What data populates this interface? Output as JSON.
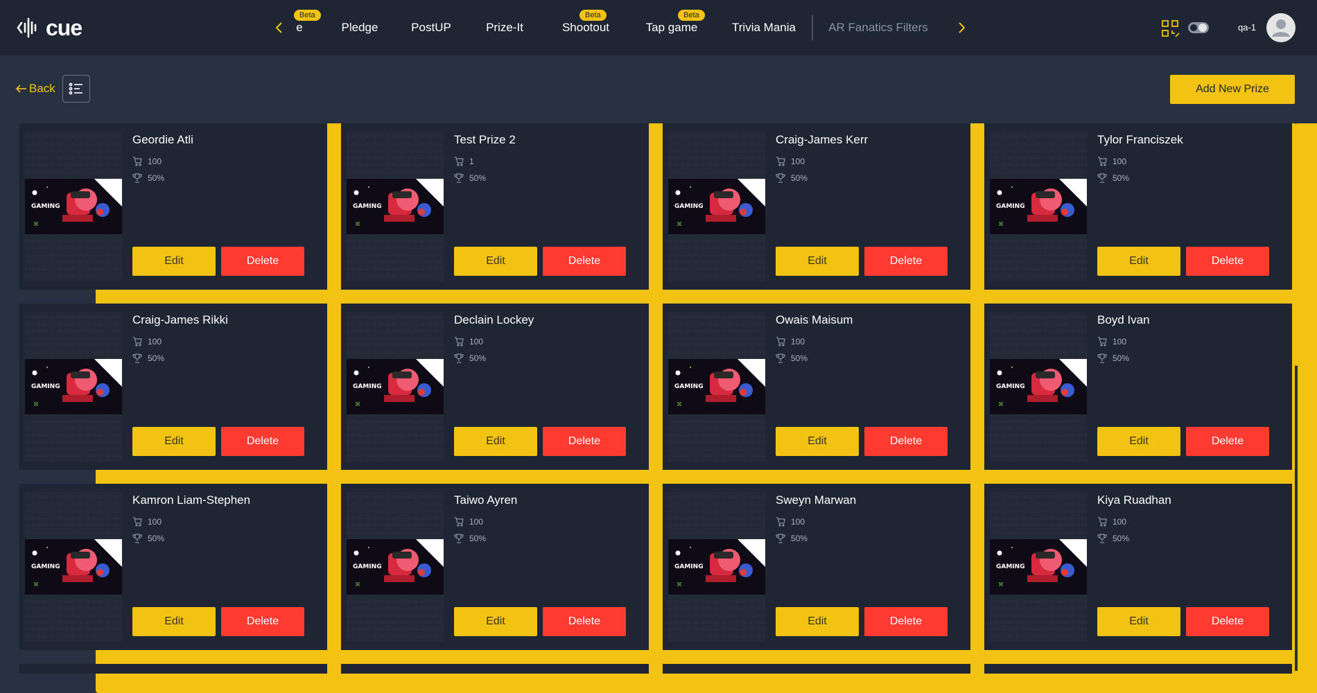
{
  "app": {
    "logo_text": "cue",
    "user_label": "qa-1"
  },
  "nav": {
    "tabs": [
      {
        "label": "e",
        "badge": "Beta"
      },
      {
        "label": "Pledge",
        "badge": ""
      },
      {
        "label": "PostUP",
        "badge": ""
      },
      {
        "label": "Prize-It",
        "badge": ""
      },
      {
        "label": "Shootout",
        "badge": "Beta"
      },
      {
        "label": "Tap game",
        "badge": "Beta"
      },
      {
        "label": "Trivia Mania",
        "badge": ""
      },
      {
        "label": "AR Fanatics Filters",
        "badge": ""
      }
    ]
  },
  "toolbar": {
    "back_label": "Back",
    "add_label": "Add New Prize"
  },
  "thumb_text": "GAMING",
  "prizes": [
    {
      "name": "Geordie Atli",
      "quantity": "100",
      "percent": "50%"
    },
    {
      "name": "Test Prize 2",
      "quantity": "1",
      "percent": "50%"
    },
    {
      "name": "Craig-James Kerr",
      "quantity": "100",
      "percent": "50%"
    },
    {
      "name": "Tylor Franciszek",
      "quantity": "100",
      "percent": "50%"
    },
    {
      "name": "Craig-James Rikki",
      "quantity": "100",
      "percent": "50%"
    },
    {
      "name": "Declain Lockey",
      "quantity": "100",
      "percent": "50%"
    },
    {
      "name": "Owais Maisum",
      "quantity": "100",
      "percent": "50%"
    },
    {
      "name": "Boyd Ivan",
      "quantity": "100",
      "percent": "50%"
    },
    {
      "name": "Kamron Liam-Stephen",
      "quantity": "100",
      "percent": "50%"
    },
    {
      "name": "Taiwo Ayren",
      "quantity": "100",
      "percent": "50%"
    },
    {
      "name": "Sweyn Marwan",
      "quantity": "100",
      "percent": "50%"
    },
    {
      "name": "Kiya Ruadhan",
      "quantity": "100",
      "percent": "50%"
    }
  ],
  "card_actions": {
    "edit_label": "Edit",
    "delete_label": "Delete"
  },
  "colors": {
    "accent": "#f2c313",
    "danger": "#ff3a30",
    "background": "#273142",
    "card": "#1e2533"
  }
}
